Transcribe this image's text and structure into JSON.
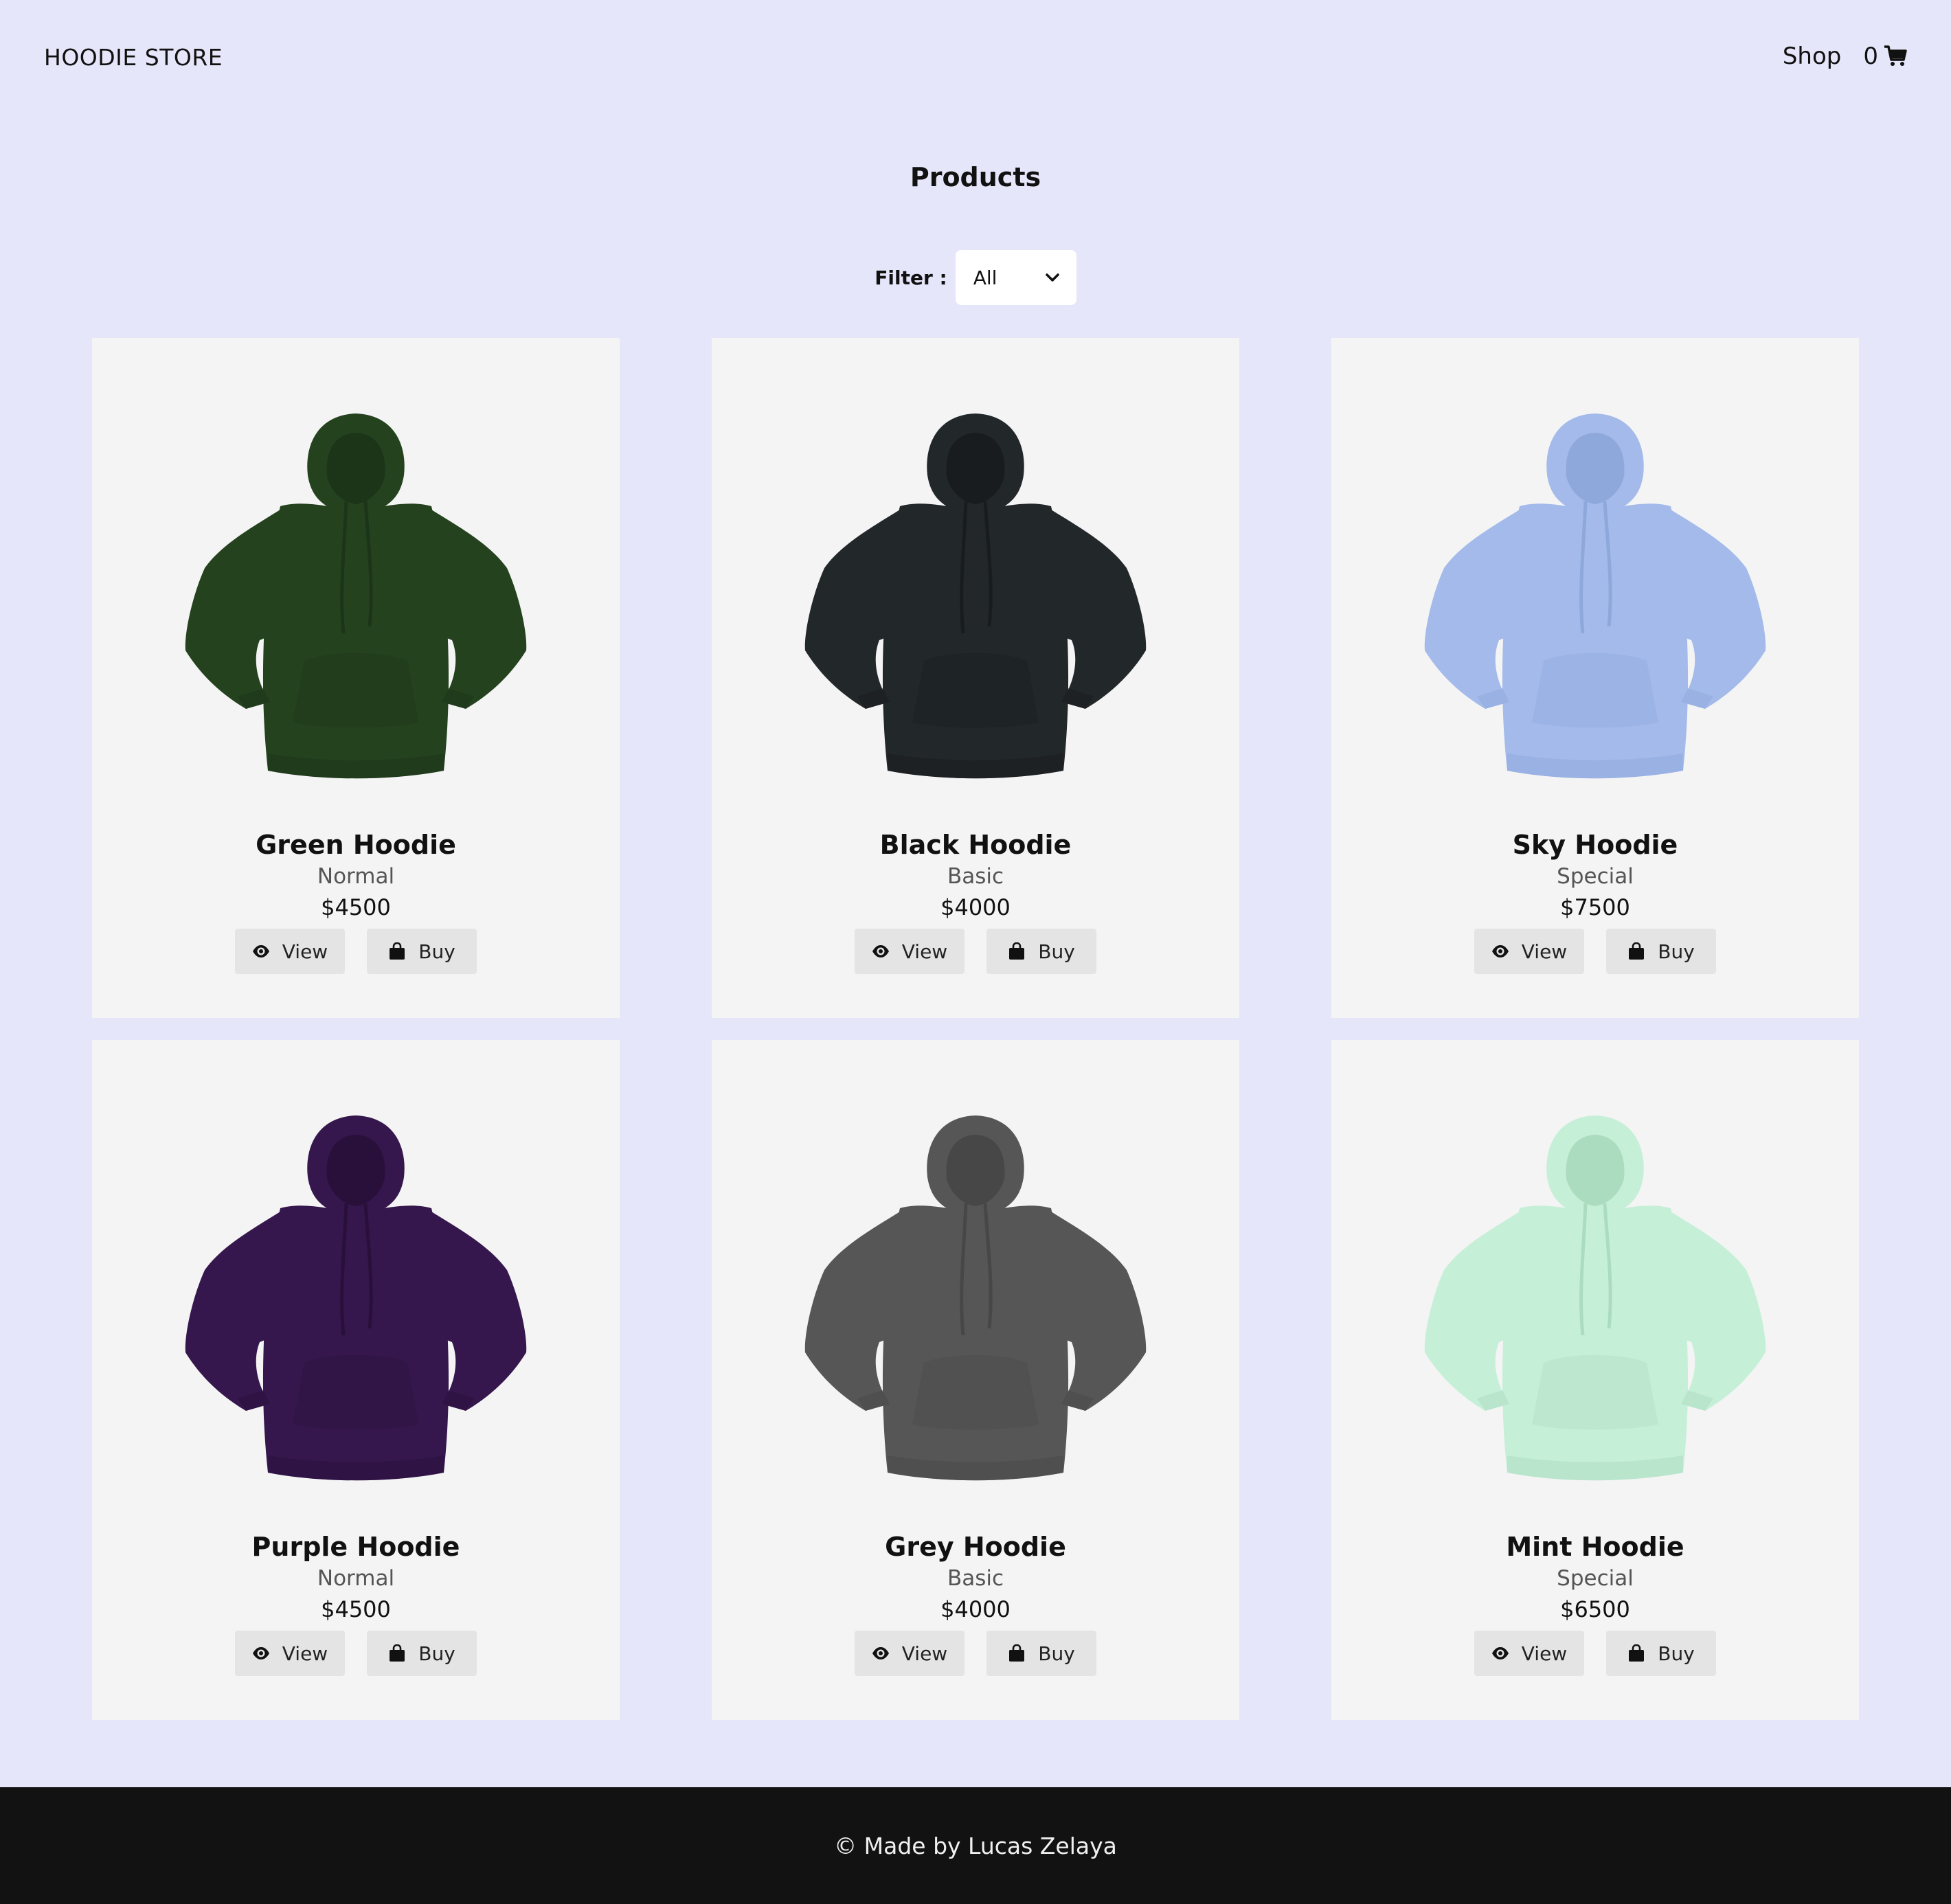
{
  "header": {
    "brand": "HOODIE STORE",
    "nav_shop": "Shop",
    "cart_count": "0"
  },
  "main": {
    "title": "Products",
    "filter_label": "Filter :",
    "filter_selected": "All"
  },
  "products": [
    {
      "name": "Green Hoodie",
      "type": "Normal",
      "price": "$4500",
      "color": "#25421f",
      "shade": "#1c3418"
    },
    {
      "name": "Black Hoodie",
      "type": "Basic",
      "price": "$4000",
      "color": "#22272a",
      "shade": "#181c1e"
    },
    {
      "name": "Sky Hoodie",
      "type": "Special",
      "price": "$7500",
      "color": "#a3baea",
      "shade": "#8fa8dc"
    },
    {
      "name": "Purple Hoodie",
      "type": "Normal",
      "price": "$4500",
      "color": "#36174d",
      "shade": "#28103b"
    },
    {
      "name": "Grey Hoodie",
      "type": "Basic",
      "price": "$4000",
      "color": "#565656",
      "shade": "#474747"
    },
    {
      "name": "Mint Hoodie",
      "type": "Special",
      "price": "$6500",
      "color": "#c6efd8",
      "shade": "#acdcc0"
    }
  ],
  "actions": {
    "view_label": "View",
    "buy_label": "Buy"
  },
  "footer": {
    "text": "© Made by Lucas Zelaya"
  },
  "icons": {
    "cart": "cart-icon",
    "view": "eye-icon",
    "buy": "shopping-bag-icon",
    "select": "chevron-down-icon"
  },
  "colors": {
    "background": "#e6e6fa",
    "card": "#f4f4f4",
    "button": "#e4e4e4",
    "footer": "#121212"
  }
}
